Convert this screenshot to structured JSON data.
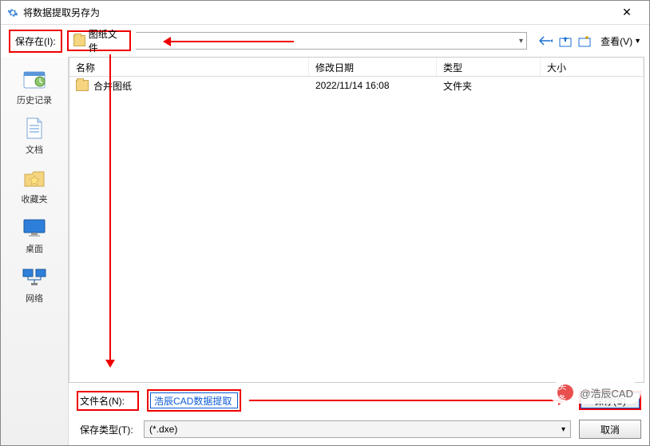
{
  "window": {
    "title": "将数据提取另存为"
  },
  "toolbar": {
    "save_in_label": "保存在(I):",
    "save_in_value": "图纸文件",
    "view_label": "查看(V)"
  },
  "sidebar": {
    "items": [
      {
        "label": "历史记录",
        "icon": "history"
      },
      {
        "label": "文档",
        "icon": "document"
      },
      {
        "label": "收藏夹",
        "icon": "favorites"
      },
      {
        "label": "桌面",
        "icon": "desktop"
      },
      {
        "label": "网络",
        "icon": "network"
      }
    ]
  },
  "columns": {
    "name": "名称",
    "date": "修改日期",
    "type": "类型",
    "size": "大小"
  },
  "files": [
    {
      "name": "合并图纸",
      "date": "2022/11/14 16:08",
      "type": "文件夹"
    }
  ],
  "bottom": {
    "filename_label": "文件名(N):",
    "filename_value": "浩辰CAD数据提取",
    "filetype_label": "保存类型(T):",
    "filetype_value": "(*.dxe)",
    "save_btn": "保存(S)",
    "cancel_btn": "取消"
  },
  "watermark": {
    "prefix": "头条",
    "text": "@浩辰CAD"
  }
}
